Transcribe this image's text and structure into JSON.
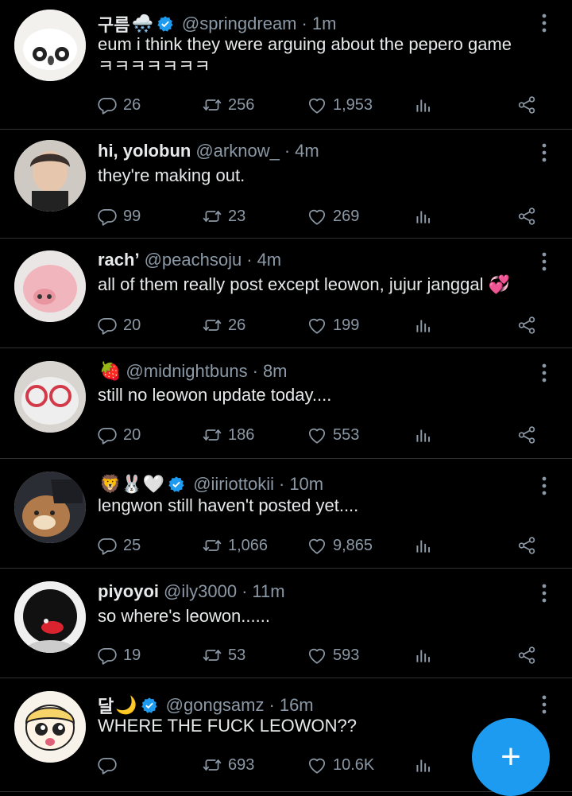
{
  "colors": {
    "background": "#000000",
    "text": "#e7e9ea",
    "secondary": "#8b98a5",
    "accent": "#1d9bf0",
    "divider": "#2f3336"
  },
  "tweets": [
    {
      "name": "구름",
      "emoji": "🌨️",
      "verified": true,
      "handle": "@springdream",
      "time": "1m",
      "text": "eum i think they were arguing about the pepero game\nㅋㅋㅋㅋㅋㅋㅋ",
      "replies": "26",
      "retweets": "256",
      "likes": "1,953"
    },
    {
      "name": "hi, yolobun",
      "emoji": "",
      "verified": false,
      "handle": "@arknow_",
      "time": "4m",
      "text": "they're making out.",
      "replies": "99",
      "retweets": "23",
      "likes": "269"
    },
    {
      "name": "rach’",
      "emoji": "",
      "verified": false,
      "handle": "@peachsoju",
      "time": "4m",
      "text": "all of them really post except leowon, jujur janggal 💞",
      "replies": "20",
      "retweets": "26",
      "likes": "199"
    },
    {
      "name": "",
      "emoji": "🍓",
      "verified": false,
      "handle": "@midnightbuns",
      "time": "8m",
      "text": "still no leowon update today....",
      "replies": "20",
      "retweets": "186",
      "likes": "553"
    },
    {
      "name": "",
      "emoji": "🦁🐰🤍",
      "verified": true,
      "handle": "@iiriottokii",
      "time": "10m",
      "text": "lengwon still haven't posted yet....",
      "replies": "25",
      "retweets": "1,066",
      "likes": "9,865"
    },
    {
      "name": "piyoyoi",
      "emoji": "",
      "verified": false,
      "handle": "@ily3000",
      "time": "11m",
      "text": "so where's leowon......",
      "replies": "19",
      "retweets": "53",
      "likes": "593"
    },
    {
      "name": "달",
      "emoji": "🌙",
      "verified": true,
      "handle": "@gongsamz",
      "time": "16m",
      "text": "WHERE THE FUCK LEOWON??",
      "replies": "",
      "retweets": "693",
      "likes": "10.6K"
    }
  ],
  "compose_button": {
    "label": "+",
    "icon": "compose-plus-icon"
  }
}
